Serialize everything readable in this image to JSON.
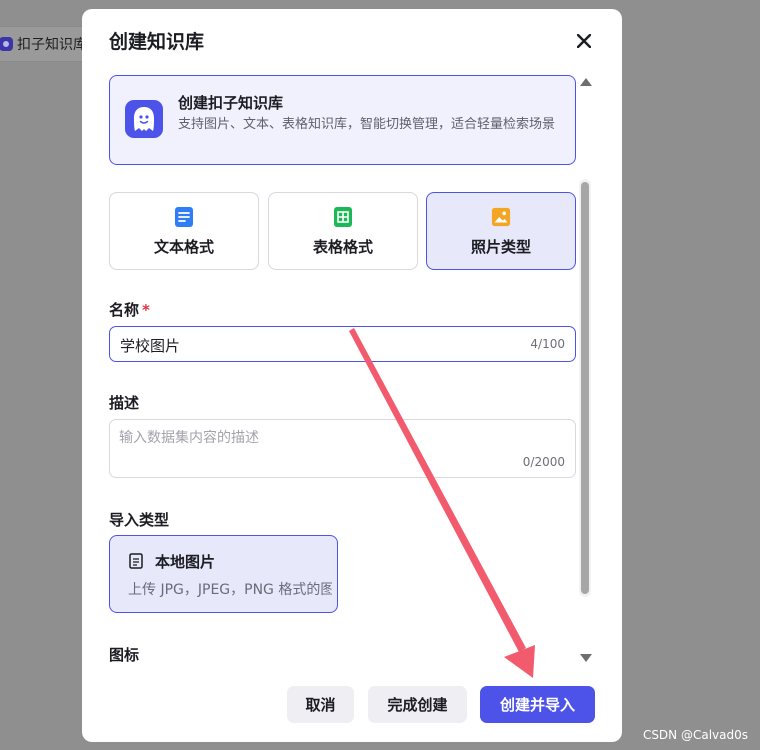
{
  "background": {
    "tab_label": "扣子知识库"
  },
  "dialog": {
    "title": "创建知识库",
    "close_icon": "close-icon",
    "kb_card": {
      "title": "创建扣子知识库",
      "description": "支持图片、文本、表格知识库，智能切换管理，适合轻量检索场景"
    },
    "types": [
      {
        "label": "文本格式",
        "icon": "document-icon",
        "selected": false
      },
      {
        "label": "表格格式",
        "icon": "table-icon",
        "selected": false
      },
      {
        "label": "照片类型",
        "icon": "image-icon",
        "selected": true
      }
    ],
    "name_field": {
      "label": "名称",
      "required_mark": "*",
      "value": "学校图片",
      "count": "4/100"
    },
    "desc_field": {
      "label": "描述",
      "placeholder": "输入数据集内容的描述",
      "count": "0/2000"
    },
    "import_type": {
      "label": "导入类型",
      "option_title": "本地图片",
      "option_sub": "上传 JPG，JPEG，PNG 格式的图片"
    },
    "icon_label": "图标",
    "buttons": {
      "cancel": "取消",
      "finish": "完成创建",
      "create_import": "创建并导入"
    }
  },
  "annotation": {
    "arrow_color": "#f25a6e"
  },
  "colors": {
    "accent": "#4d53e8",
    "overlay": "#8f8f8f"
  },
  "watermark": "CSDN @Calvad0s"
}
